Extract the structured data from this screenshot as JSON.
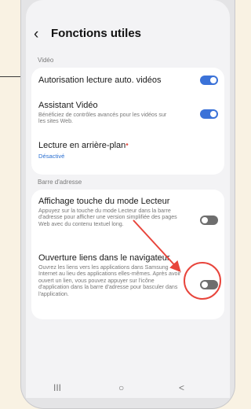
{
  "header": {
    "back_icon": "chevron-left-icon",
    "title": "Fonctions utiles"
  },
  "sections": {
    "video": "Vidéo",
    "address_bar": "Barre d'adresse"
  },
  "video_items": [
    {
      "title": "Autorisation lecture auto. vidéos",
      "toggle": "on"
    },
    {
      "title": "Assistant Vidéo",
      "desc": "Bénéficiez de contrôles avancés pour les vidéos sur les sites Web.",
      "toggle": "on"
    },
    {
      "title": "Lecture en arrière-plan",
      "sub": "Désactivé"
    }
  ],
  "address_items": [
    {
      "title": "Affichage touche du mode Lecteur",
      "desc": "Appuyez sur la touche du mode Lecteur dans la barre d'adresse pour afficher une version simplifiée des pages Web avec du contenu textuel long.",
      "toggle": "off"
    },
    {
      "title": "Ouverture liens dans le navigateur",
      "desc": "Ouvrez les liens vers les applications dans Samsung Internet au lieu des applications elles-mêmes. Après avoir ouvert un lien, vous pouvez appuyer sur l'icône d'application dans la barre d'adresse pour basculer dans l'application.",
      "toggle": "off"
    }
  ],
  "navbar": {
    "recents": "III",
    "home": "○",
    "back": "<"
  },
  "annotation": {
    "color": "#e8453c"
  }
}
